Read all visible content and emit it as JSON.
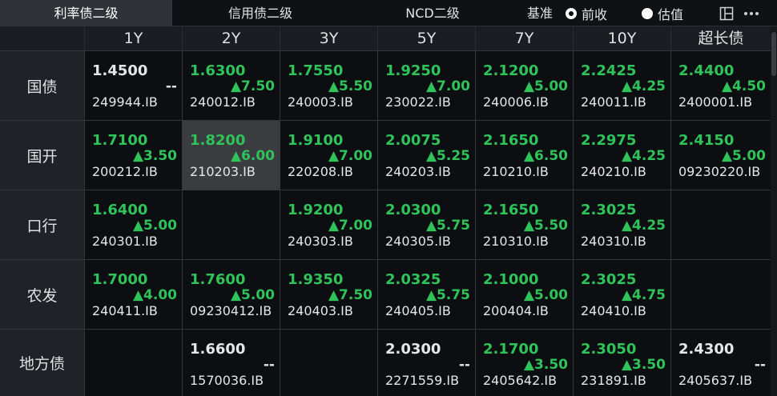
{
  "tabs": [
    {
      "label": "利率债二级",
      "active": true
    },
    {
      "label": "信用债二级",
      "active": false
    },
    {
      "label": "NCD二级",
      "active": false
    }
  ],
  "benchmark": {
    "label": "基准",
    "options": [
      {
        "label": "前收",
        "checked": true
      },
      {
        "label": "估值",
        "checked": false
      }
    ]
  },
  "toolbar": {
    "layout_icon": "layout-icon",
    "more_icon": "more-icon"
  },
  "columns": [
    "1Y",
    "2Y",
    "3Y",
    "5Y",
    "7Y",
    "10Y",
    "超长债"
  ],
  "rows": [
    {
      "label": "国债",
      "cells": [
        {
          "yield": "1.4500",
          "change": "--",
          "code": "249944.IB",
          "dir": "flat"
        },
        {
          "yield": "1.6300",
          "change": "▲7.50",
          "code": "240012.IB",
          "dir": "up"
        },
        {
          "yield": "1.7550",
          "change": "▲5.50",
          "code": "240003.IB",
          "dir": "up"
        },
        {
          "yield": "1.9250",
          "change": "▲7.00",
          "code": "230022.IB",
          "dir": "up"
        },
        {
          "yield": "2.1200",
          "change": "▲5.00",
          "code": "240006.IB",
          "dir": "up"
        },
        {
          "yield": "2.2425",
          "change": "▲4.25",
          "code": "240011.IB",
          "dir": "up"
        },
        {
          "yield": "2.4400",
          "change": "▲4.50",
          "code": "2400001.IB",
          "dir": "up"
        }
      ]
    },
    {
      "label": "国开",
      "cells": [
        {
          "yield": "1.7100",
          "change": "▲3.50",
          "code": "200212.IB",
          "dir": "up"
        },
        {
          "yield": "1.8200",
          "change": "▲6.00",
          "code": "210203.IB",
          "dir": "up",
          "selected": true
        },
        {
          "yield": "1.9100",
          "change": "▲7.00",
          "code": "220208.IB",
          "dir": "up"
        },
        {
          "yield": "2.0075",
          "change": "▲5.25",
          "code": "240203.IB",
          "dir": "up"
        },
        {
          "yield": "2.1650",
          "change": "▲6.50",
          "code": "210210.IB",
          "dir": "up"
        },
        {
          "yield": "2.2975",
          "change": "▲4.25",
          "code": "240210.IB",
          "dir": "up"
        },
        {
          "yield": "2.4150",
          "change": "▲5.00",
          "code": "09230220.IB",
          "dir": "up"
        }
      ]
    },
    {
      "label": "口行",
      "cells": [
        {
          "yield": "1.6400",
          "change": "▲5.00",
          "code": "240301.IB",
          "dir": "up"
        },
        null,
        {
          "yield": "1.9200",
          "change": "▲7.00",
          "code": "240303.IB",
          "dir": "up"
        },
        {
          "yield": "2.0300",
          "change": "▲5.75",
          "code": "240305.IB",
          "dir": "up"
        },
        {
          "yield": "2.1650",
          "change": "▲5.50",
          "code": "210310.IB",
          "dir": "up"
        },
        {
          "yield": "2.3025",
          "change": "▲4.25",
          "code": "240310.IB",
          "dir": "up"
        },
        null
      ]
    },
    {
      "label": "农发",
      "cells": [
        {
          "yield": "1.7000",
          "change": "▲4.00",
          "code": "240411.IB",
          "dir": "up"
        },
        {
          "yield": "1.7600",
          "change": "▲5.00",
          "code": "09230412.IB",
          "dir": "up"
        },
        {
          "yield": "1.9350",
          "change": "▲7.50",
          "code": "240403.IB",
          "dir": "up"
        },
        {
          "yield": "2.0325",
          "change": "▲5.75",
          "code": "240405.IB",
          "dir": "up"
        },
        {
          "yield": "2.1000",
          "change": "▲5.00",
          "code": "200404.IB",
          "dir": "up"
        },
        {
          "yield": "2.3025",
          "change": "▲4.75",
          "code": "240410.IB",
          "dir": "up"
        },
        null
      ]
    },
    {
      "label": "地方债",
      "cells": [
        null,
        {
          "yield": "1.6600",
          "change": "--",
          "code": "1570036.IB",
          "dir": "flat"
        },
        null,
        {
          "yield": "2.0300",
          "change": "--",
          "code": "2271559.IB",
          "dir": "flat"
        },
        {
          "yield": "2.1700",
          "change": "▲3.50",
          "code": "2405642.IB",
          "dir": "up"
        },
        {
          "yield": "2.3050",
          "change": "▲3.50",
          "code": "231891.IB",
          "dir": "up"
        },
        {
          "yield": "2.4300",
          "change": "--",
          "code": "2405637.IB",
          "dir": "flat"
        }
      ]
    }
  ],
  "colors": {
    "up": "#2fc35a",
    "flat": "#e4e6e9",
    "selected_bg": "#3a3c40"
  }
}
